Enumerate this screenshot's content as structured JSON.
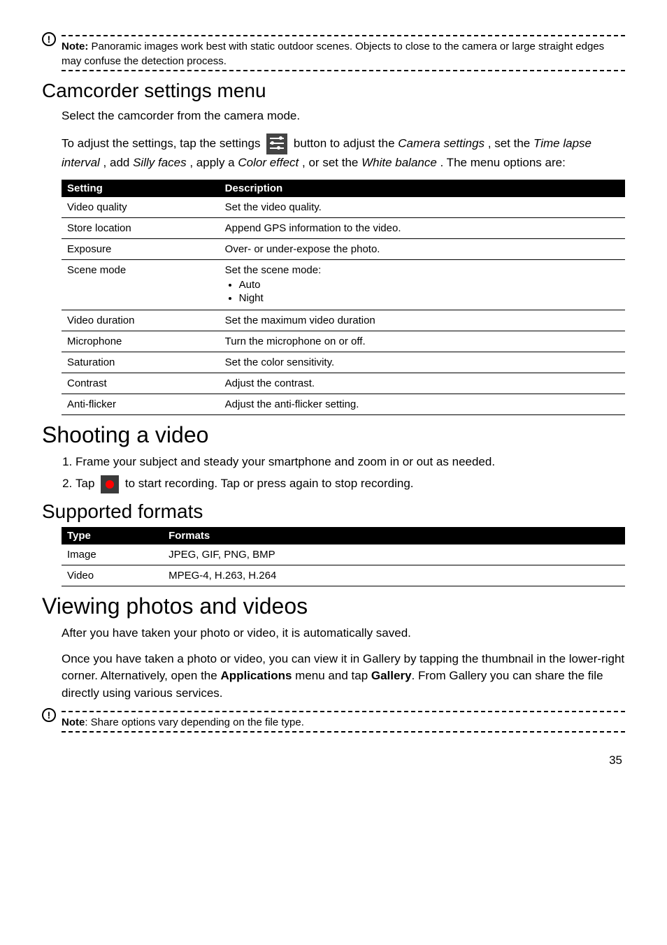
{
  "note1": {
    "label": "Note:",
    "text": " Panoramic images work best with static outdoor scenes. Objects to close to the camera or large straight edges may confuse the detection process."
  },
  "h2_camcorder": "Camcorder settings menu",
  "p_select_camcorder": "Select the camcorder from the camera mode.",
  "p_adjust_pre": "To adjust the settings, tap the settings ",
  "p_adjust_mid1": " button to adjust the ",
  "p_adjust_em1": "Camera settings",
  "p_adjust_mid2": ", set the ",
  "p_adjust_em2": "Time lapse interval",
  "p_adjust_mid3": ", add ",
  "p_adjust_em3": "Silly faces",
  "p_adjust_mid4": ", apply a ",
  "p_adjust_em4": "Color effect",
  "p_adjust_mid5": ", or set the ",
  "p_adjust_em5": "White balance",
  "p_adjust_end": ". The menu options are:",
  "settings_table": {
    "head": {
      "c1": "Setting",
      "c2": "Description"
    },
    "rows": [
      {
        "c1": "Video quality",
        "c2": "Set the video quality."
      },
      {
        "c1": "Store location",
        "c2": "Append GPS information to the video."
      },
      {
        "c1": "Exposure",
        "c2": "Over- or under-expose the photo."
      },
      {
        "c1": "Scene mode",
        "c2": "Set the scene mode:",
        "bullets": [
          "Auto",
          "Night"
        ]
      },
      {
        "c1": "Video duration",
        "c2": "Set the maximum video duration"
      },
      {
        "c1": "Microphone",
        "c2": "Turn the microphone on or off."
      },
      {
        "c1": "Saturation",
        "c2": "Set the color sensitivity."
      },
      {
        "c1": "Contrast",
        "c2": "Adjust the contrast."
      },
      {
        "c1": "Anti-flicker",
        "c2": "Adjust the anti-flicker setting."
      }
    ]
  },
  "h1_shooting": "Shooting a video",
  "steps": {
    "s1": "Frame your subject and steady your smartphone and zoom in or out as needed.",
    "s2_pre": "Tap ",
    "s2_post": " to start recording. Tap or press again to stop recording."
  },
  "h2_formats": "Supported formats",
  "formats_table": {
    "head": {
      "c1": "Type",
      "c2": "Formats"
    },
    "rows": [
      {
        "c1": "Image",
        "c2": "JPEG, GIF, PNG, BMP"
      },
      {
        "c1": "Video",
        "c2": "MPEG-4, H.263, H.264"
      }
    ]
  },
  "h1_viewing": "Viewing photos and videos",
  "p_after_taken": "After you have taken your photo or video, it is automatically saved.",
  "p_once_pre": "Once you have taken a photo or video, you can view it in Gallery by tapping the thumbnail in the lower-right corner. Alternatively, open the ",
  "p_once_b1": "Applications",
  "p_once_mid": " menu and tap ",
  "p_once_b2": "Gallery",
  "p_once_post": ". From Gallery you can share the file directly using various services.",
  "note2": {
    "label": "Note",
    "text": ": Share options vary depending on the file type."
  },
  "page_number": "35"
}
